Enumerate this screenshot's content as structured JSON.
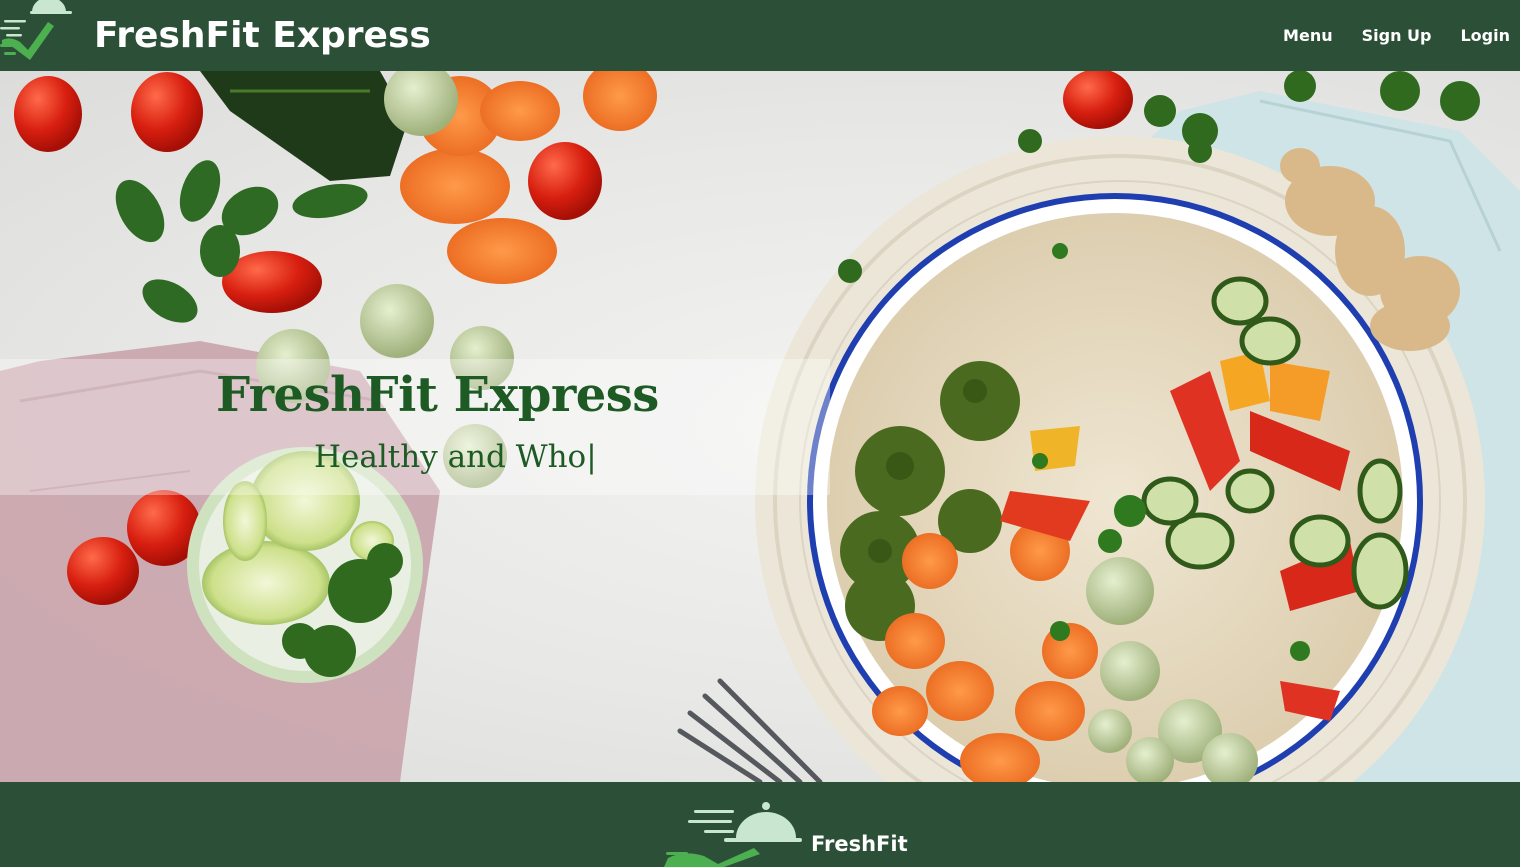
{
  "header": {
    "brand_name": "FreshFit Express",
    "nav": [
      {
        "label": "Menu"
      },
      {
        "label": "Sign Up"
      },
      {
        "label": "Login"
      }
    ]
  },
  "hero": {
    "title": "FreshFit Express",
    "subtitle": "Healthy and Who|"
  },
  "footer": {
    "brand_name": "FreshFit"
  },
  "colors": {
    "header_bg": "#2c5037",
    "footer_bg": "#2c5037",
    "hero_text": "#1d5a24",
    "logo_green": "#4caf50",
    "logo_mint": "#c8e6d0"
  },
  "icons": {
    "header_logo": "food-delivery-logo-icon",
    "footer_logo": "food-delivery-logo-icon"
  }
}
